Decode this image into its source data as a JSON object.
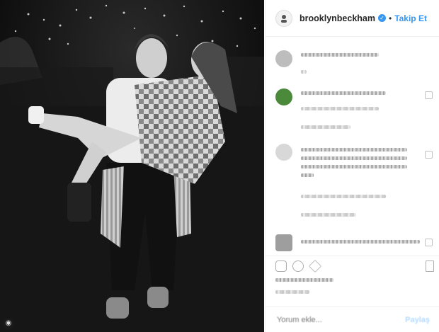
{
  "post": {
    "username": "brooklynbeckham",
    "verified_mark": "✓",
    "separator": "•",
    "follow_label": "Takip Et"
  },
  "comment_box": {
    "placeholder": "Yorum ekle...",
    "post_label": "Paylaş"
  },
  "icons": {
    "profile": "avatar-icon",
    "photo_corner": "camera-icon",
    "like": "heart-icon",
    "comment": "comment-icon",
    "share": "share-icon",
    "save": "bookmark-icon"
  },
  "colors": {
    "accent": "#3897f0",
    "text": "#262626",
    "divider": "#efefef",
    "photo_bg": "#0b0b0b"
  }
}
